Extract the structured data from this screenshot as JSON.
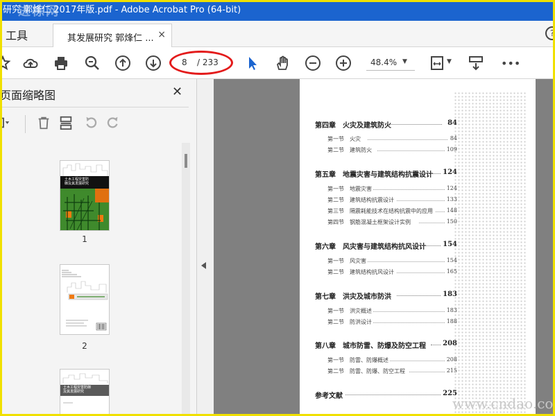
{
  "window": {
    "title": "研究 郭烽仁 2017年版.pdf - Adobe Acrobat Pro (64-bit)"
  },
  "tabs": {
    "tools_label": "工具",
    "doc_label": "其发展研究 郭烽仁 ...",
    "close_glyph": "×"
  },
  "toolbar": {
    "page_current": "8",
    "page_total": "/ 233",
    "zoom": "48.4%",
    "more_glyph": "•••",
    "accent_annotation": "#e31b1b",
    "select_tool_color": "#1b64cf"
  },
  "sidebar": {
    "title": "页面缩略图",
    "close_glyph": "✕",
    "thumbnails": [
      {
        "label": "1",
        "cover_title": "土木工程灾害防御及其发展研究"
      },
      {
        "label": "2"
      },
      {
        "cover_title": "土木工程灾害防御及其发展研究"
      }
    ]
  },
  "document": {
    "chapters": [
      {
        "title": "第四章　火灾及建筑防火",
        "page": "84",
        "sections": [
          {
            "num": "第一节",
            "title": "火灾",
            "page": "84"
          },
          {
            "num": "第二节",
            "title": "建筑防火",
            "page": "109"
          }
        ]
      },
      {
        "title": "第五章　地震灾害与建筑结构抗震设计",
        "page": "124",
        "sections": [
          {
            "num": "第一节",
            "title": "地震灾害",
            "page": "124"
          },
          {
            "num": "第二节",
            "title": "建筑结构抗震设计",
            "page": "133"
          },
          {
            "num": "第三节",
            "title": "隔震耗能技术在结构抗震中的应用",
            "page": "148"
          },
          {
            "num": "第四节",
            "title": "钢筋混凝土框架设计实例",
            "page": "150"
          }
        ]
      },
      {
        "title": "第六章　风灾害与建筑结构抗风设计",
        "page": "154",
        "sections": [
          {
            "num": "第一节",
            "title": "风灾害",
            "page": "154"
          },
          {
            "num": "第二节",
            "title": "建筑结构抗风设计",
            "page": "165"
          }
        ]
      },
      {
        "title": "第七章　洪灾及城市防洪",
        "page": "183",
        "sections": [
          {
            "num": "第一节",
            "title": "洪灾概述",
            "page": "183"
          },
          {
            "num": "第二节",
            "title": "防洪设计",
            "page": "188"
          }
        ]
      },
      {
        "title": "第八章　城市防雷、防爆及防空工程",
        "page": "208",
        "sections": [
          {
            "num": "第一节",
            "title": "防雷、防爆概述",
            "page": "208"
          },
          {
            "num": "第二节",
            "title": "防雷、防爆、防空工程",
            "page": "215"
          }
        ]
      },
      {
        "title": "参考文献",
        "page": "225",
        "sections": []
      }
    ]
  },
  "watermarks": {
    "top": "进棕网",
    "bottom": "www.cndao.co"
  }
}
